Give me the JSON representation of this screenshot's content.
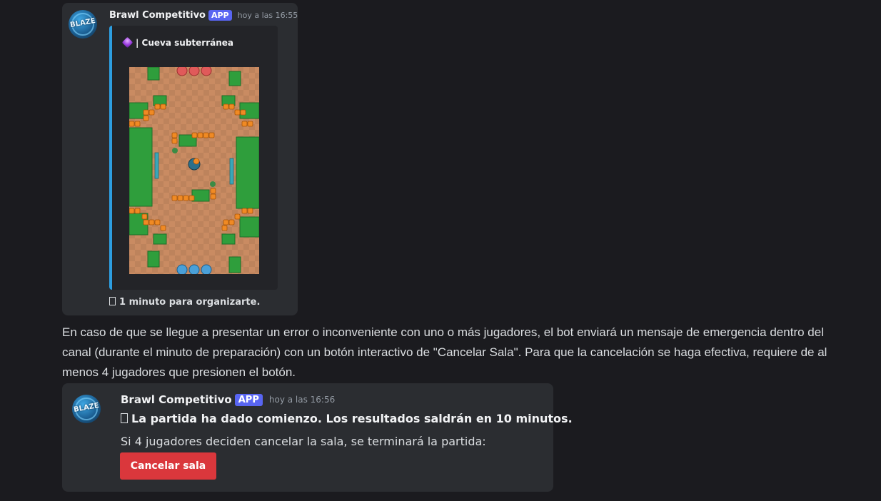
{
  "message1": {
    "username": "Brawl Competitivo",
    "app_badge": "APP",
    "timestamp": "hoy a las 16:55",
    "avatar_text": "BLAZE",
    "embed": {
      "title": "| Cueva subterránea",
      "title_icon": "purple-gem-icon",
      "accent_color": "#2d9ee0",
      "map_image": "cueva-subterranea-map"
    },
    "footer": "1 minuto para organizarte."
  },
  "paragraph": "En caso de que se llegue a presentar un error o inconveniente con uno o más jugadores, el bot enviará un mensaje de emergencia dentro del canal (durante el minuto de preparación) con un botón interactivo de \"Cancelar Sala\". Para que la cancelación se haga efectiva, requiere de al menos 4 jugadores que presionen el botón.",
  "message2": {
    "username": "Brawl Competitivo",
    "app_badge": "APP",
    "timestamp": "hoy a las 16:56",
    "avatar_text": "BLAZE",
    "bold_line": "La partida ha dado comienzo. Los resultados saldrán en 10 minutos.",
    "normal_line": "Si 4 jugadores deciden cancelar la sala, se terminará la partida:",
    "button_label": "Cancelar sala",
    "button_color": "#da373c"
  },
  "colors": {
    "background": "#1b1b1f",
    "card": "#2b2d31",
    "app_badge": "#5865f2"
  }
}
